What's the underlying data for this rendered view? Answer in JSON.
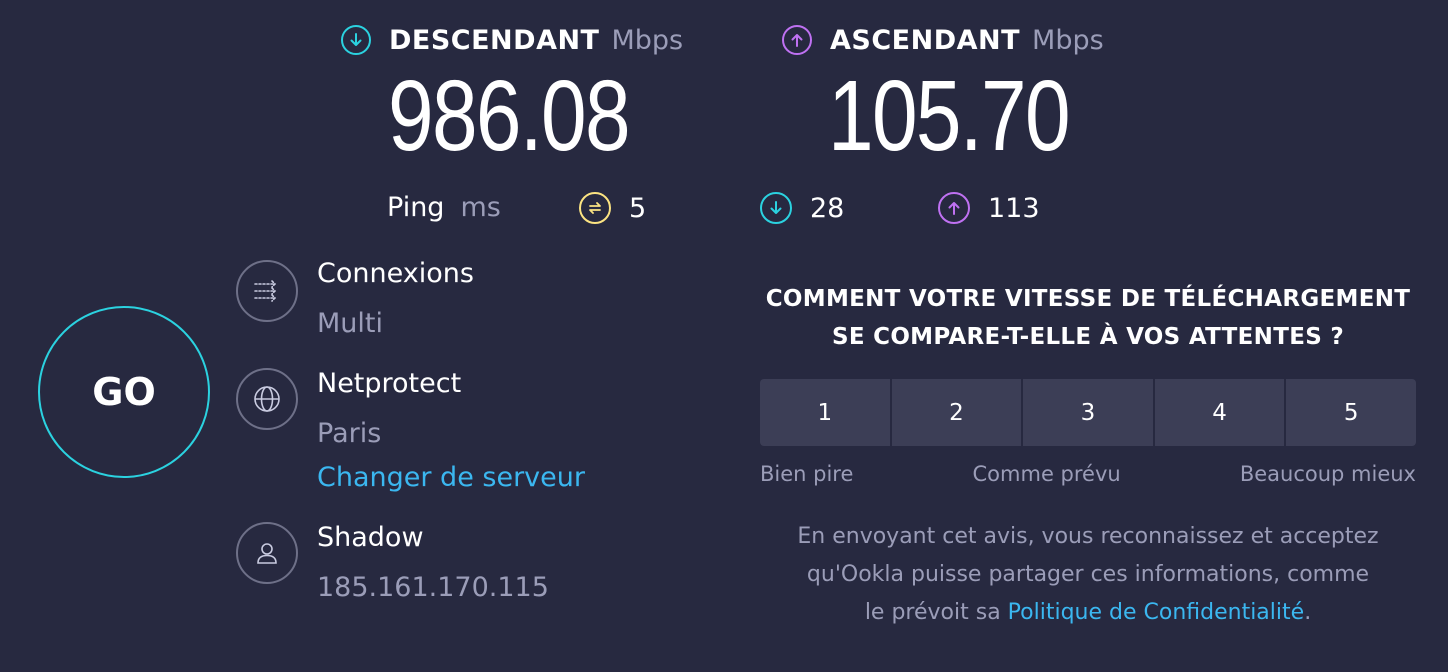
{
  "download": {
    "label": "DESCENDANT",
    "unit": "Mbps",
    "value": "986.08",
    "icon": "download-arrow-icon",
    "color": "#2bd2e0"
  },
  "upload": {
    "label": "ASCENDANT",
    "unit": "Mbps",
    "value": "105.70",
    "icon": "upload-arrow-icon",
    "color": "#bf71f2"
  },
  "ping": {
    "label": "Ping",
    "unit": "ms",
    "idle": "5",
    "download": "28",
    "upload": "113",
    "idle_color": "#fbe382"
  },
  "go_label": "GO",
  "connections": {
    "title": "Connexions",
    "value": "Multi"
  },
  "server": {
    "title": "Netprotect",
    "location": "Paris",
    "change_link": "Changer de serveur"
  },
  "provider": {
    "title": "Shadow",
    "ip": "185.161.170.115"
  },
  "survey": {
    "question_line1": "COMMENT VOTRE VITESSE DE TÉLÉCHARGEMENT",
    "question_line2": "SE COMPARE-T-ELLE À VOS ATTENTES ?",
    "options": [
      "1",
      "2",
      "3",
      "4",
      "5"
    ],
    "scale_low": "Bien pire",
    "scale_mid": "Comme prévu",
    "scale_high": "Beaucoup mieux",
    "disclaimer_line1": "En envoyant cet avis, vous reconnaissez et acceptez",
    "disclaimer_line2": "qu'Ookla puisse partager ces informations, comme",
    "disclaimer_line3_pre": "le prévoit sa ",
    "privacy_link": "Politique de Confidentialité",
    "disclaimer_line3_post": "."
  }
}
